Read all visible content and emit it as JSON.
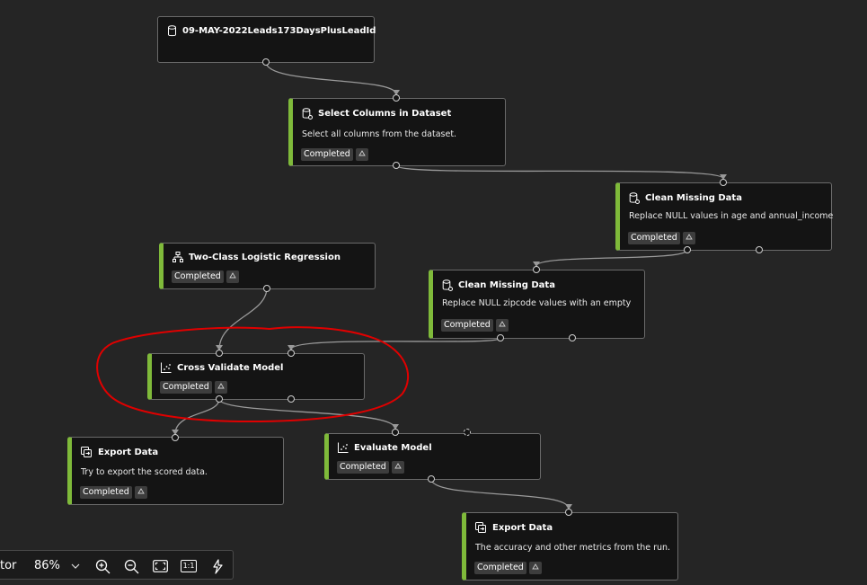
{
  "nodes": {
    "dataset": {
      "title": "09-MAY-2022Leads173DaysPlusLeadId",
      "icon": "dataset-icon"
    },
    "select_columns": {
      "title": "Select Columns in Dataset",
      "description": "Select all columns from the dataset.",
      "status": "Completed",
      "icon": "module-icon"
    },
    "clean_missing_1": {
      "title": "Clean Missing Data",
      "description": "Replace NULL values in age and annual_income",
      "status": "Completed",
      "icon": "module-icon"
    },
    "clean_missing_2": {
      "title": "Clean Missing Data",
      "description": "Replace NULL zipcode values with an empty",
      "status": "Completed",
      "icon": "module-icon"
    },
    "logistic_regression": {
      "title": "Two-Class Logistic Regression",
      "status": "Completed",
      "icon": "algorithm-icon"
    },
    "cross_validate": {
      "title": "Cross Validate Model",
      "status": "Completed",
      "icon": "scatter-chart-icon"
    },
    "export_data_1": {
      "title": "Export Data",
      "description": "Try to export the scored data.",
      "status": "Completed",
      "icon": "export-icon"
    },
    "evaluate_model": {
      "title": "Evaluate Model",
      "status": "Completed",
      "icon": "scatter-chart-icon"
    },
    "export_data_2": {
      "title": "Export Data",
      "description": "The accuracy and other metrics from the run.",
      "status": "Completed",
      "icon": "export-icon"
    }
  },
  "toolbar": {
    "partial_label": "tor",
    "zoom_level": "86%",
    "actual_size_label": "1:1",
    "icons": [
      "chevron-down-icon",
      "zoom-in-icon",
      "zoom-out-icon",
      "fit-to-screen-icon",
      "auto-layout-icon"
    ]
  },
  "colors": {
    "canvas": "#252525",
    "node_background": "#141414",
    "completed_accent": "#7fba3a",
    "highlight_annotation": "#e00000",
    "connector": "#9a9a9a"
  }
}
